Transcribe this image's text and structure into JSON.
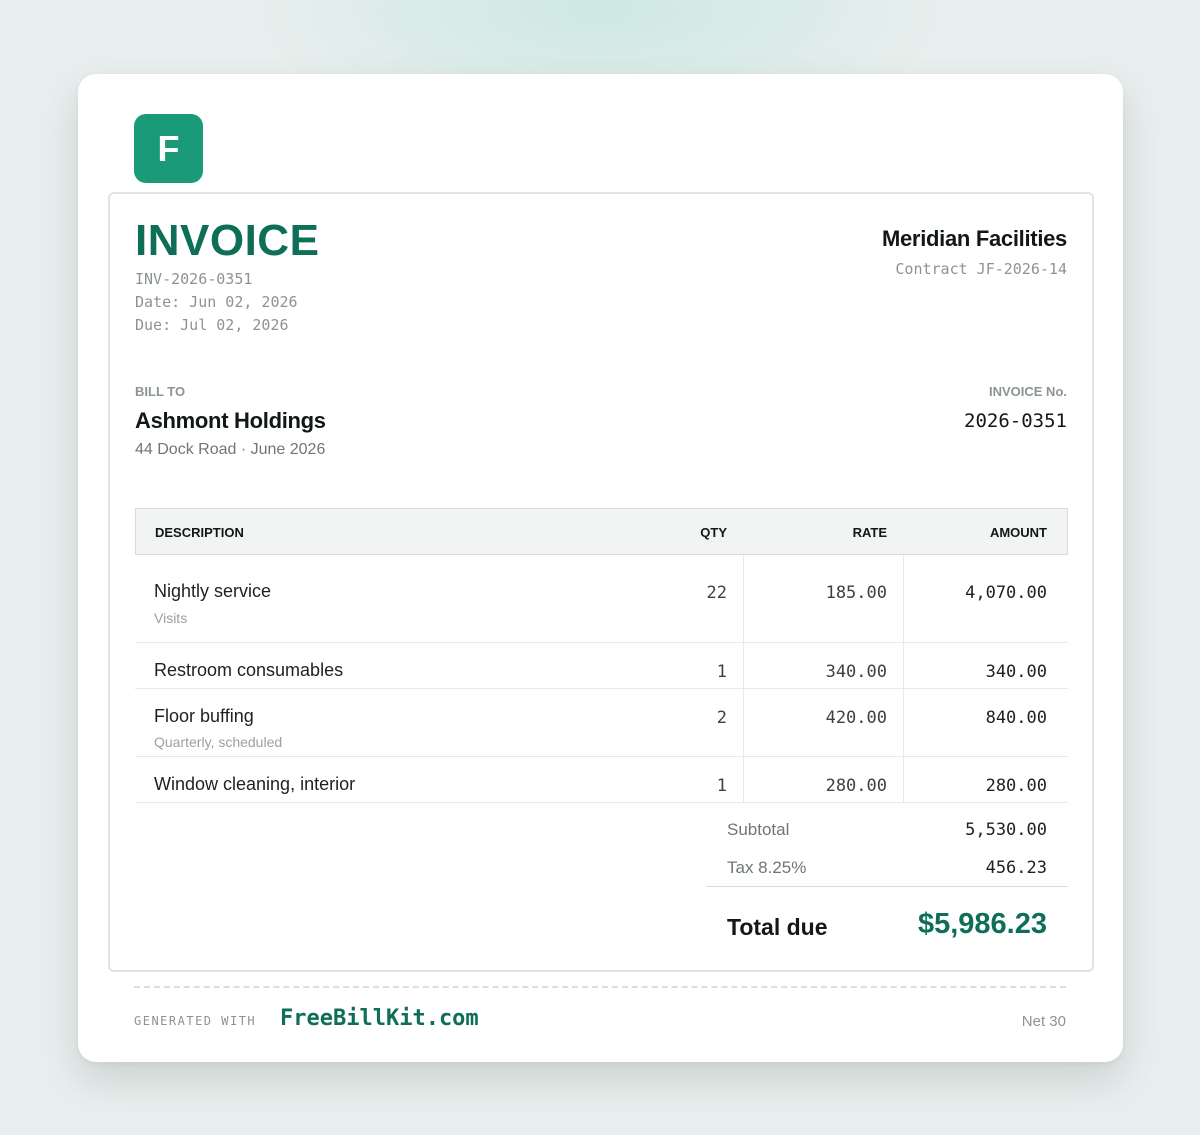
{
  "logo": {
    "letter": "F",
    "color": "#1a9a78"
  },
  "invoice": {
    "title": "INVOICE",
    "number_line": "INV-2026-0351",
    "date_line": "Date: Jun 02, 2026",
    "due_line": "Due: Jul 02, 2026"
  },
  "vendor": {
    "name": "Meridian Facilities",
    "contract": "Contract JF-2026-14"
  },
  "bill_to": {
    "label": "BILL TO",
    "name": "Ashmont Holdings",
    "address": "44 Dock Road · June 2026"
  },
  "invoice_no": {
    "label": "INVOICE No.",
    "value": "2026-0351"
  },
  "table": {
    "headers": {
      "description": "DESCRIPTION",
      "qty": "QTY",
      "rate": "RATE",
      "amount": "AMOUNT"
    },
    "rows": [
      {
        "description": "Nightly service",
        "sub": "Visits",
        "qty": "22",
        "rate": "185.00",
        "amount": "4,070.00"
      },
      {
        "description": "Restroom consumables",
        "sub": "",
        "qty": "1",
        "rate": "340.00",
        "amount": "340.00"
      },
      {
        "description": "Floor buffing",
        "sub": "Quarterly, scheduled",
        "qty": "2",
        "rate": "420.00",
        "amount": "840.00"
      },
      {
        "description": "Window cleaning, interior",
        "sub": "",
        "qty": "1",
        "rate": "280.00",
        "amount": "280.00"
      }
    ]
  },
  "totals": {
    "subtotal_label": "Subtotal",
    "subtotal": "5,530.00",
    "tax_label": "Tax 8.25%",
    "tax": "456.23",
    "total_label": "Total due",
    "total": "$5,986.23"
  },
  "footer": {
    "generated_label": "GENERATED WITH",
    "brand": "FreeBillKit.com",
    "terms": "Net 30"
  },
  "colors": {
    "accent": "#0e6e57",
    "background": "#e9efee"
  }
}
